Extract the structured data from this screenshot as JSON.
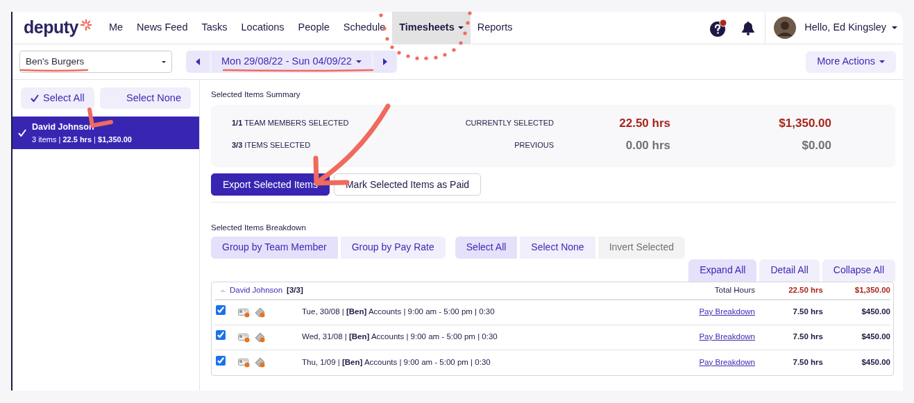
{
  "navbar": {
    "logo": "deputy",
    "items": [
      {
        "label": "Me",
        "selected": false,
        "has_menu": false
      },
      {
        "label": "News Feed",
        "selected": false,
        "has_menu": false
      },
      {
        "label": "Tasks",
        "selected": false,
        "has_menu": false
      },
      {
        "label": "Locations",
        "selected": false,
        "has_menu": false
      },
      {
        "label": "People",
        "selected": false,
        "has_menu": false
      },
      {
        "label": "Schedule",
        "selected": false,
        "has_menu": false
      },
      {
        "label": "Timesheets",
        "selected": true,
        "has_menu": true
      },
      {
        "label": "Reports",
        "selected": false,
        "has_menu": false
      }
    ],
    "help_alert": true,
    "user_greeting": "Hello, Ed Kingsley"
  },
  "toolbar": {
    "location": "Ben's Burgers",
    "date_range": "Mon 29/08/22 - Sun 04/09/22",
    "more_actions": "More Actions"
  },
  "sidebar": {
    "buttons": [
      {
        "label": "Select All",
        "kind": "check"
      },
      {
        "label": "Select None",
        "kind": "plain"
      }
    ],
    "members": [
      {
        "name": "David Johnson",
        "summary": "3 items | **22.5 hrs** | **$1,350.00**",
        "selected": true
      }
    ]
  },
  "summary": {
    "title": "Selected Items Summary",
    "rows": [
      {
        "kind": "current",
        "label": "**1/1** TEAM MEMBERS SELECTED",
        "status": "CURRENTLY SELECTED",
        "hours": "22.50 hrs",
        "amount": "$1,350.00"
      },
      {
        "kind": "previous",
        "label": "**3/3** ITEMS SELECTED",
        "status": "PREVIOUS",
        "hours": "0.00 hrs",
        "amount": "$0.00"
      }
    ],
    "actions": [
      {
        "label": "Export Selected Items",
        "kind": "primary"
      },
      {
        "label": "Mark Selected Items as Paid",
        "kind": "outline"
      }
    ]
  },
  "breakdown": {
    "title": "Selected Items Breakdown",
    "group_buttons": [
      {
        "label": "Group by Team Member",
        "selected": true
      },
      {
        "label": "Group by Pay Rate",
        "selected": false
      }
    ],
    "selection_buttons": [
      {
        "label": "Select All",
        "selected": true,
        "disabled": false
      },
      {
        "label": "Select None",
        "selected": false,
        "disabled": false
      },
      {
        "label": "Invert Selected",
        "selected": false,
        "disabled": true
      }
    ],
    "view_buttons": [
      {
        "label": "Expand All",
        "selected": true
      },
      {
        "label": "Detail All",
        "selected": false
      },
      {
        "label": "Collapse All",
        "selected": false
      }
    ],
    "groups": [
      {
        "name": "David Johnson",
        "count": "[3/3]",
        "expanded": true,
        "total_label": "Total Hours",
        "hours": "22.50 hrs",
        "amount": "$1,350.00",
        "rows": [
          {
            "checked": true,
            "description": "Tue, 30/08 | **[Ben]** Accounts | 9:00 am - 5:00 pm | 0:30",
            "link": "Pay Breakdown",
            "hours": "7.50 hrs",
            "amount": "$450.00"
          },
          {
            "checked": true,
            "description": "Wed, 31/08 | **[Ben]** Accounts | 9:00 am - 5:00 pm | 0:30",
            "link": "Pay Breakdown",
            "hours": "7.50 hrs",
            "amount": "$450.00"
          },
          {
            "checked": true,
            "description": "Thu, 1/09 | **[Ben]** Accounts | 9:00 am - 5:00 pm | 0:30",
            "link": "Pay Breakdown",
            "hours": "7.50 hrs",
            "amount": "$450.00"
          }
        ]
      }
    ]
  }
}
